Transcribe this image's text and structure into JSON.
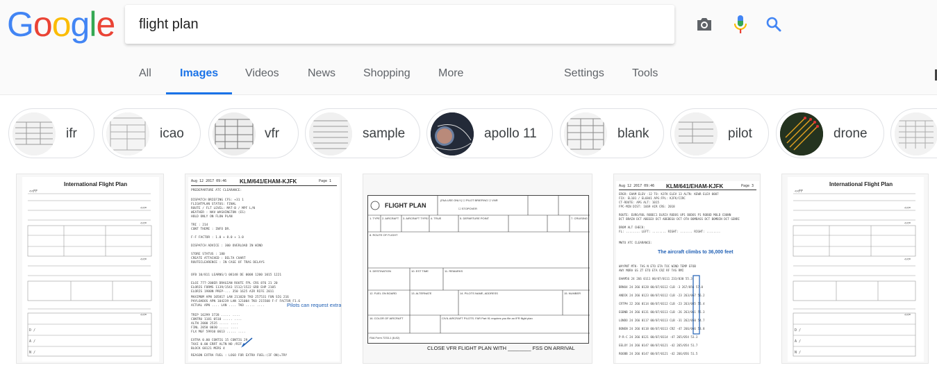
{
  "logo": {
    "letters": [
      "G",
      "o",
      "o",
      "g",
      "l",
      "e"
    ],
    "colors": [
      "#4285F4",
      "#EA4335",
      "#FBBC05",
      "#4285F4",
      "#34A853",
      "#EA4335"
    ]
  },
  "search": {
    "value": "flight plan",
    "camera_icon": "camera-icon",
    "mic_icon": "microphone-icon",
    "search_icon": "search-icon"
  },
  "tabs": {
    "all": "All",
    "images": "Images",
    "videos": "Videos",
    "news": "News",
    "shopping": "Shopping",
    "more": "More",
    "settings": "Settings",
    "tools": "Tools"
  },
  "chips": [
    "ifr",
    "icao",
    "vfr",
    "sample",
    "apollo 11",
    "blank",
    "pilot",
    "drone"
  ],
  "results": {
    "r1": {
      "title": "International Flight Plan"
    },
    "r2": {
      "date": "Aug 12 2017 09:46",
      "title": "KLM/641/EHAM-KJFK",
      "page": "Page 1",
      "note": "Pilots can request extra fuel"
    },
    "r3": {
      "title": "FLIGHT PLAN",
      "footer": "CLOSE VFR FLIGHT PLAN WITH ________ FSS ON ARRIVAL"
    },
    "r4": {
      "date": "Aug 12 2017 09:46",
      "title": "KLM/641/EHAM-KJFK",
      "page": "Page 3",
      "note": "The aircraft climbs to 36,000 feet"
    },
    "r5": {
      "title": "International Flight Plan"
    }
  },
  "accent": "#1a73e8"
}
